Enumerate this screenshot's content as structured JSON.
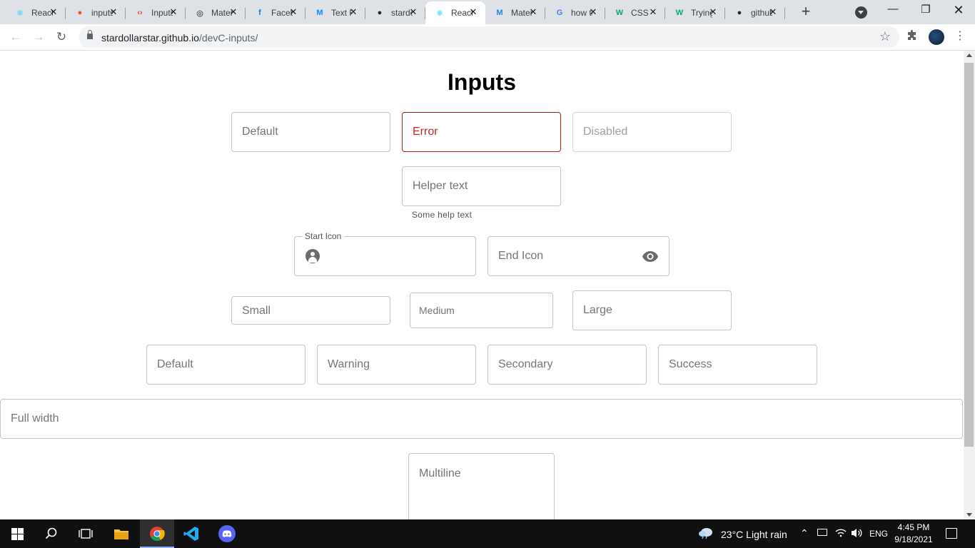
{
  "browser": {
    "tabs": [
      {
        "title": "React App",
        "favicon": "react-icon",
        "color": "#61dafb"
      },
      {
        "title": "inputs",
        "favicon": "figma-icon",
        "color": "#f24e1e"
      },
      {
        "title": "Inputs",
        "favicon": "code-icon",
        "color": "#e53935"
      },
      {
        "title": "Material",
        "favicon": "globe-icon",
        "color": "#5f6368"
      },
      {
        "title": "Facebook",
        "favicon": "facebook-icon",
        "color": "#1877f2"
      },
      {
        "title": "Text Field",
        "favicon": "mui-icon",
        "color": "#1e88e5"
      },
      {
        "title": "stardollarstar",
        "favicon": "github-icon",
        "color": "#24292e"
      },
      {
        "title": "React App",
        "favicon": "react-icon",
        "color": "#61dafb",
        "active": true
      },
      {
        "title": "Material",
        "favicon": "mui-icon",
        "color": "#1e88e5"
      },
      {
        "title": "how to",
        "favicon": "google-icon",
        "color": "#4285f4"
      },
      {
        "title": "CSS",
        "favicon": "w3schools-icon",
        "color": "#04aa6d"
      },
      {
        "title": "Trying",
        "favicon": "w3schools-icon",
        "color": "#04aa6d"
      },
      {
        "title": "github",
        "favicon": "github-icon",
        "color": "#24292e"
      }
    ],
    "new_tab": "+",
    "url_host": "stardollarstar.github.io",
    "url_path": "/devC-inputs/"
  },
  "page": {
    "title": "Inputs",
    "row1": {
      "default": "Default",
      "error": "Error",
      "disabled": "Disabled"
    },
    "helper": {
      "label": "Helper text",
      "help": "Some help text"
    },
    "icons": {
      "start_label": "Start Icon",
      "end_placeholder": "End Icon"
    },
    "sizes": {
      "small": "Small",
      "medium": "Medium",
      "large": "Large"
    },
    "colors": {
      "default": "Default",
      "warning": "Warning",
      "secondary": "Secondary",
      "success": "Success"
    },
    "full_width": "Full width",
    "multiline": "Multiline"
  },
  "taskbar": {
    "weather": "23°C  Light rain",
    "language": "ENG",
    "time": "4:45 PM",
    "date": "9/18/2021"
  }
}
